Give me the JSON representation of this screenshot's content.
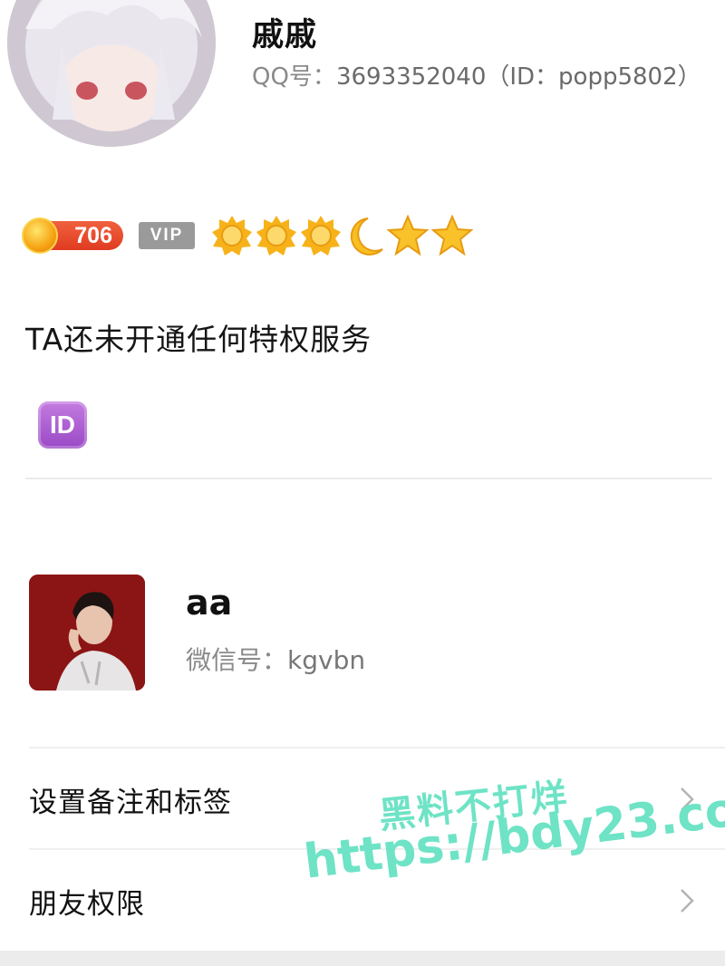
{
  "qq_profile": {
    "nickname": "戚戚",
    "number_prefix": "QQ号：",
    "number_value": "3693352040（ID：popp5802）",
    "level_value": "706",
    "vip_label": "VIP",
    "rank_icons": [
      "sun-icon",
      "sun-icon",
      "sun-icon",
      "moon-icon",
      "star-icon",
      "star-icon"
    ],
    "privilege_text": "TA还未开通任何特权服务",
    "id_icon_label": "ID"
  },
  "wechat_contact": {
    "name": "aa",
    "wechat_id_prefix": "微信号：",
    "wechat_id_value": "kgvbn"
  },
  "menu": {
    "items": [
      {
        "label": "设置备注和标签"
      },
      {
        "label": "朋友权限"
      }
    ]
  },
  "watermark": {
    "line1": "黑料不打烊",
    "line2": "https://bdy23.co"
  },
  "colors": {
    "level_badge": "#e6452a",
    "vip_badge": "#9a9a9a",
    "id_icon": "#a855cf",
    "watermark": "#6ee3c6",
    "contact_avatar_bg": "#8b1514"
  }
}
